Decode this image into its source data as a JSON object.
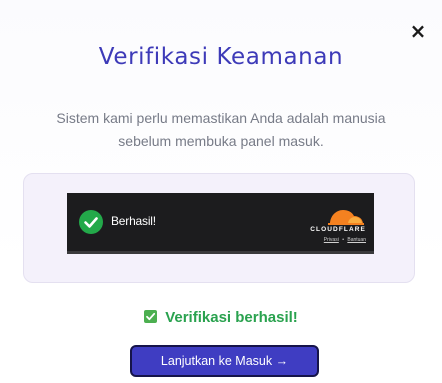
{
  "dialog": {
    "close_label": "×",
    "title": "Verifikasi Keamanan",
    "description_line1": "Sistem kami perlu memastikan Anda adalah manusia",
    "description_line2": "sebelum membuka panel masuk."
  },
  "captcha": {
    "status": "Berhasil!",
    "provider_wordmark": "CLOUDFLARE",
    "privacy_link": "Privasi",
    "separator": "•",
    "help_link": "Bantuan",
    "colors": {
      "widget_bg": "#1c1c1e",
      "check": "#23a94a",
      "logo_orange": "#f48120",
      "logo_light": "#faad3f"
    },
    "icons": {
      "status": "check-circle-icon",
      "logo": "cloudflare-cloud-icon"
    }
  },
  "result": {
    "message": "Verifikasi berhasil!",
    "icon": "checkbox-checked-icon",
    "color": "#2aa24f"
  },
  "continue_button": {
    "label": "Lanjutkan ke Masuk →",
    "color": "#3f3dc2"
  },
  "colors": {
    "title": "#3d3ab8",
    "description": "#777b87",
    "panel_bg": "#f4f1fb"
  }
}
